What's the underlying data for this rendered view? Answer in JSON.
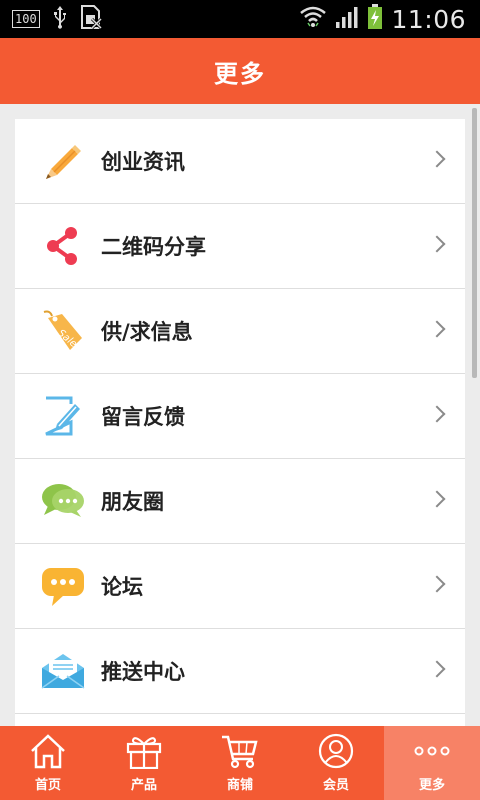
{
  "status_bar": {
    "battery_level": "100",
    "time": "11:06"
  },
  "header": {
    "title": "更多"
  },
  "menu": {
    "items": [
      {
        "label": "创业资讯",
        "icon": "pencil-icon"
      },
      {
        "label": "二维码分享",
        "icon": "share-icon"
      },
      {
        "label": "供/求信息",
        "icon": "sale-tag-icon"
      },
      {
        "label": "留言反馈",
        "icon": "edit-note-icon"
      },
      {
        "label": "朋友圈",
        "icon": "chat-bubbles-icon"
      },
      {
        "label": "论坛",
        "icon": "chat-bubble-icon"
      },
      {
        "label": "推送中心",
        "icon": "envelope-icon"
      }
    ]
  },
  "bottom_nav": {
    "items": [
      {
        "label": "首页",
        "icon": "home-icon"
      },
      {
        "label": "产品",
        "icon": "gift-icon"
      },
      {
        "label": "商铺",
        "icon": "cart-icon"
      },
      {
        "label": "会员",
        "icon": "person-icon"
      },
      {
        "label": "更多",
        "icon": "more-dots-icon",
        "active": true
      }
    ]
  },
  "colors": {
    "accent": "#f35a33",
    "active_tab": "#f78266",
    "background": "#ececec"
  }
}
